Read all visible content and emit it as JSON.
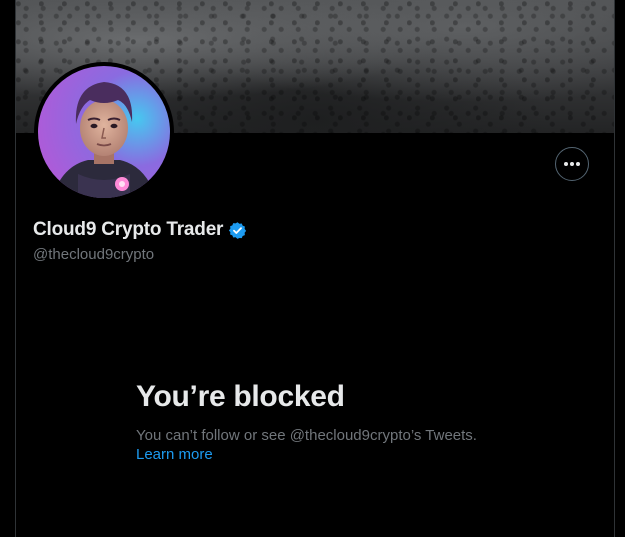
{
  "profile": {
    "display_name": "Cloud9 Crypto Trader",
    "handle": "@thecloud9crypto",
    "verified": true,
    "avatar_icon": "profile-avatar-photo",
    "more_icon": "more-horizontal-icon"
  },
  "blocked": {
    "title": "You’re blocked",
    "description": "You can’t follow or see @thecloud9crypto’s Tweets.",
    "learn_more": "Learn more"
  },
  "colors": {
    "background": "#000000",
    "primary_text": "#e7e9ea",
    "secondary_text": "#71767b",
    "link": "#1d9bf0",
    "verified_badge": "#1d9bf0",
    "border": "#2f3336"
  }
}
